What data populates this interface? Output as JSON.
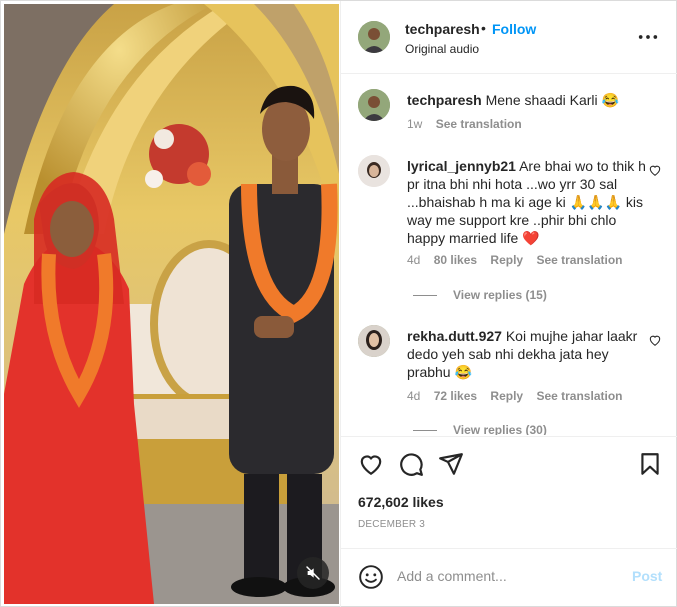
{
  "post": {
    "username": "techparesh",
    "separator": "•",
    "follow_label": "Follow",
    "audio_label": "Original audio"
  },
  "caption": {
    "username": "techparesh",
    "text": "Mene shaadi Karli 😂",
    "age": "1w",
    "see_translation": "See translation"
  },
  "comments": [
    {
      "username": "lyrical_jennyb21",
      "text": "Are bhai wo to thik h pr itna bhi nhi hota ...wo yrr 30 sal ...bhaishab h ma ki age ki 🙏🙏🙏 kis way me support kre ..phir bhi chlo happy married life ❤️",
      "age": "4d",
      "likes": "80 likes",
      "reply": "Reply",
      "see_translation": "See translation",
      "view_replies": "View replies (15)"
    },
    {
      "username": "rekha.dutt.927",
      "text": "Koi mujhe jahar laakr dedo yeh sab nhi dekha jata hey prabhu 😂",
      "age": "4d",
      "likes": "72 likes",
      "reply": "Reply",
      "see_translation": "See translation",
      "view_replies": "View replies (30)"
    }
  ],
  "stats": {
    "likes": "672,602 likes",
    "date": "DECEMBER 3"
  },
  "composer": {
    "placeholder": "Add a comment...",
    "post_label": "Post"
  },
  "icons": {
    "like": "heart-icon",
    "comment": "comment-icon",
    "share": "paper-plane-icon",
    "save": "bookmark-icon",
    "more": "more-horizontal-icon",
    "mute": "speaker-muted-icon",
    "emoji": "smiley-icon"
  },
  "colors": {
    "accent": "#0095f6",
    "post_disabled": "#b2dffc",
    "muted_text": "#8e8e8e",
    "heart_red": "#ed1c24"
  }
}
